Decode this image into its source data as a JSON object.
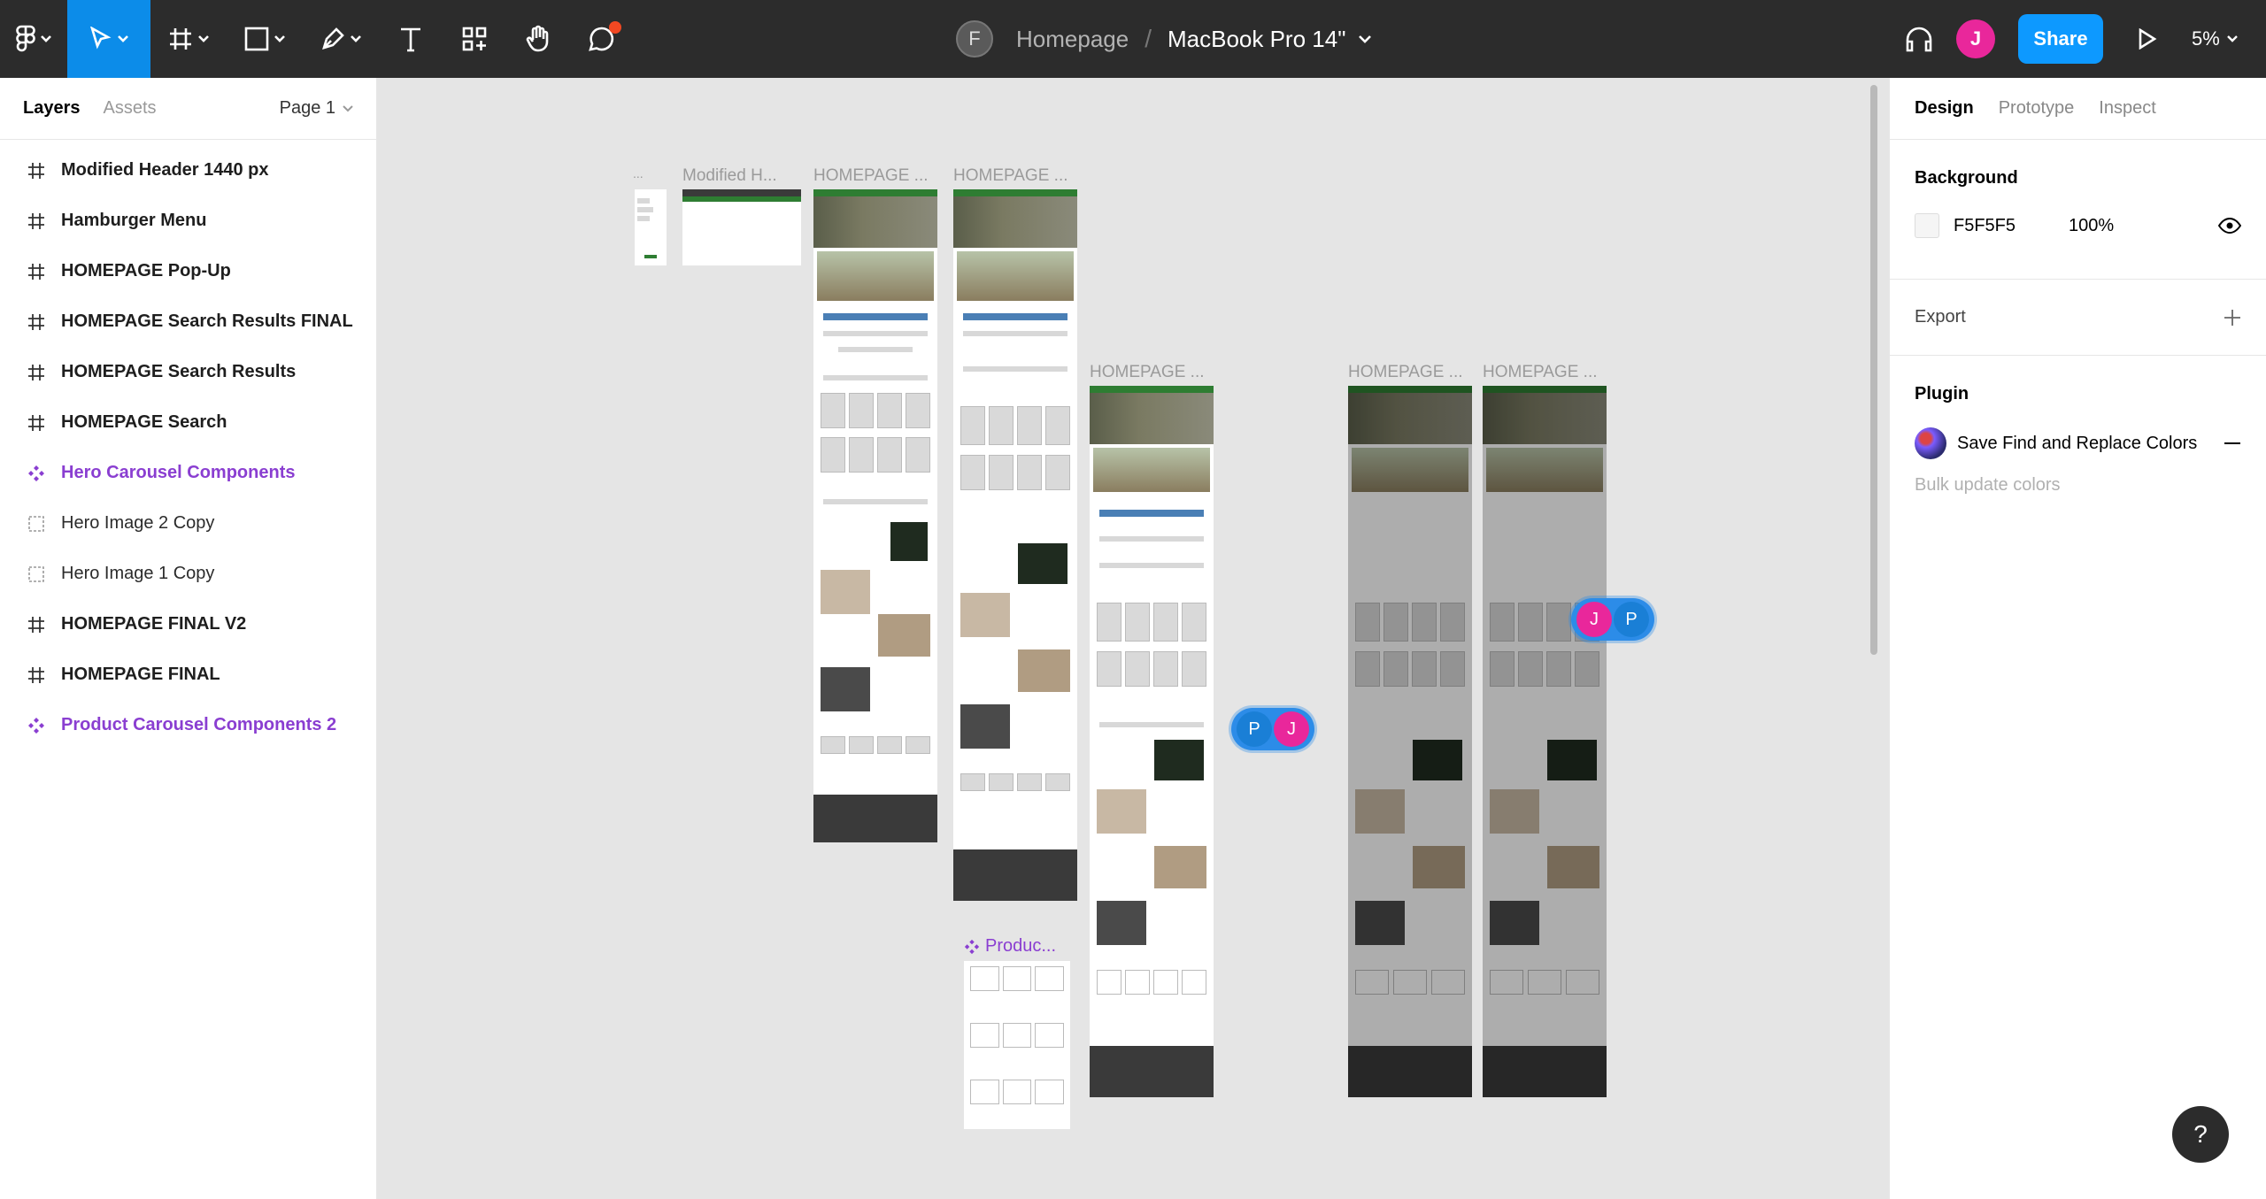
{
  "toolbar": {
    "tools": [
      "main-menu",
      "move",
      "frame",
      "shape",
      "pen",
      "text",
      "resources",
      "hand",
      "comment"
    ],
    "file_initial": "F",
    "project": "Homepage",
    "separator": "/",
    "page_name": "MacBook Pro 14\"",
    "user_initial": "J",
    "share_label": "Share",
    "zoom": "5%",
    "accent": "#0d99ff"
  },
  "left_panel": {
    "tabs": [
      "Layers",
      "Assets"
    ],
    "page_select": "Page 1",
    "layers": [
      {
        "name": "Modified Header 1440 px",
        "type": "frame"
      },
      {
        "name": "Hamburger Menu",
        "type": "frame"
      },
      {
        "name": "HOMEPAGE Pop-Up",
        "type": "frame"
      },
      {
        "name": "HOMEPAGE Search Results FINAL",
        "type": "frame"
      },
      {
        "name": "HOMEPAGE Search Results",
        "type": "frame"
      },
      {
        "name": "HOMEPAGE Search",
        "type": "frame"
      },
      {
        "name": "Hero Carousel Components",
        "type": "component"
      },
      {
        "name": "Hero Image 2 Copy",
        "type": "slice"
      },
      {
        "name": "Hero Image 1 Copy",
        "type": "slice"
      },
      {
        "name": "HOMEPAGE FINAL V2",
        "type": "frame"
      },
      {
        "name": "HOMEPAGE FINAL",
        "type": "frame"
      },
      {
        "name": "Product Carousel Components 2",
        "type": "component"
      }
    ]
  },
  "right_panel": {
    "tabs": [
      "Design",
      "Prototype",
      "Inspect"
    ],
    "background": {
      "title": "Background",
      "hex": "F5F5F5",
      "opacity": "100%"
    },
    "export": {
      "title": "Export"
    },
    "plugin": {
      "title": "Plugin",
      "name": "Save Find and Replace Colors",
      "subtitle": "Bulk update colors"
    }
  },
  "canvas": {
    "frame_labels": [
      "...",
      "Modified H...",
      "HOMEPAGE ...",
      "HOMEPAGE ...",
      "HOMEPAGE ...",
      "HOMEPAGE ...",
      "HOMEPAGE ..."
    ],
    "component_label": "Produc...",
    "cursors": [
      {
        "initials": [
          "P",
          "J"
        ]
      },
      {
        "initials": [
          "J",
          "P"
        ]
      }
    ],
    "colors": {
      "p_avatar": "#1a7fd6",
      "j_avatar": "#e9279b"
    }
  },
  "help": "?"
}
